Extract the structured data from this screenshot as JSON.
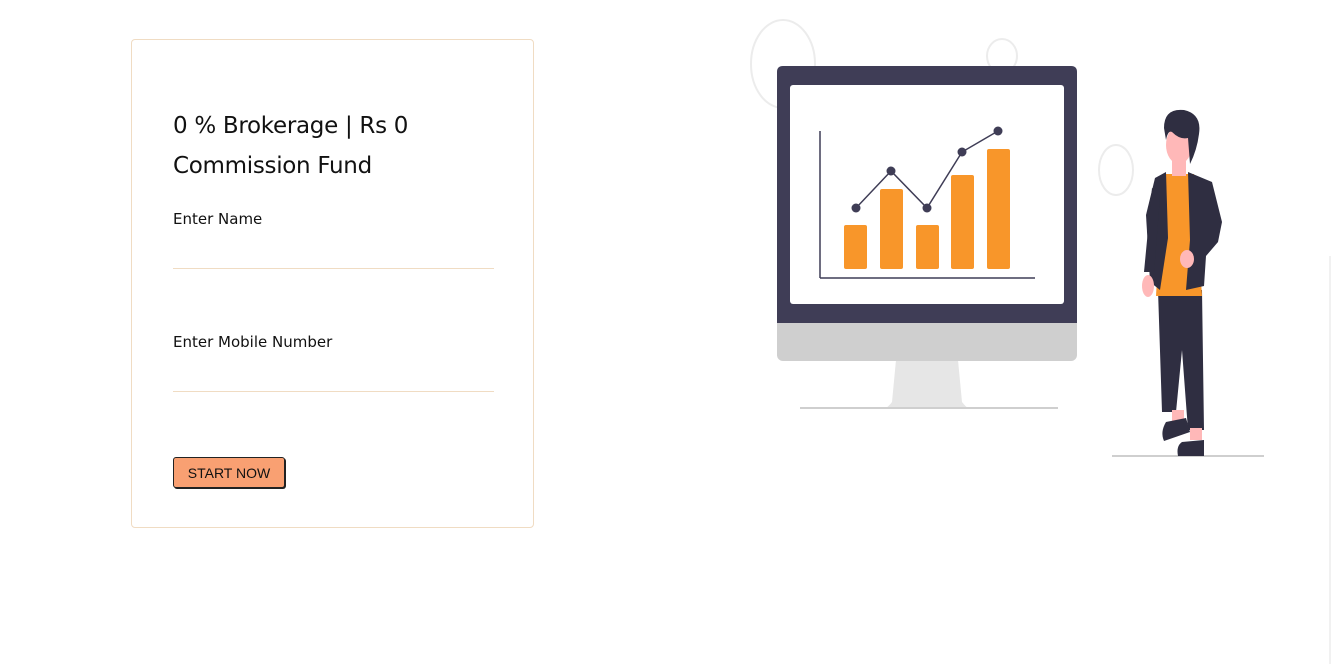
{
  "form": {
    "title": "0 % Brokerage | Rs 0 Commission Fund",
    "name_label": "Enter Name",
    "name_value": "",
    "mobile_label": "Enter Mobile Number",
    "mobile_value": "",
    "submit_label": "START NOW"
  },
  "colors": {
    "accent_orange": "#f8962a",
    "button_bg": "#f9a072",
    "monitor_frame": "#3f3d56",
    "card_border": "#f0dcc3"
  },
  "illustration": {
    "icon": "investment-growth-illustration"
  }
}
